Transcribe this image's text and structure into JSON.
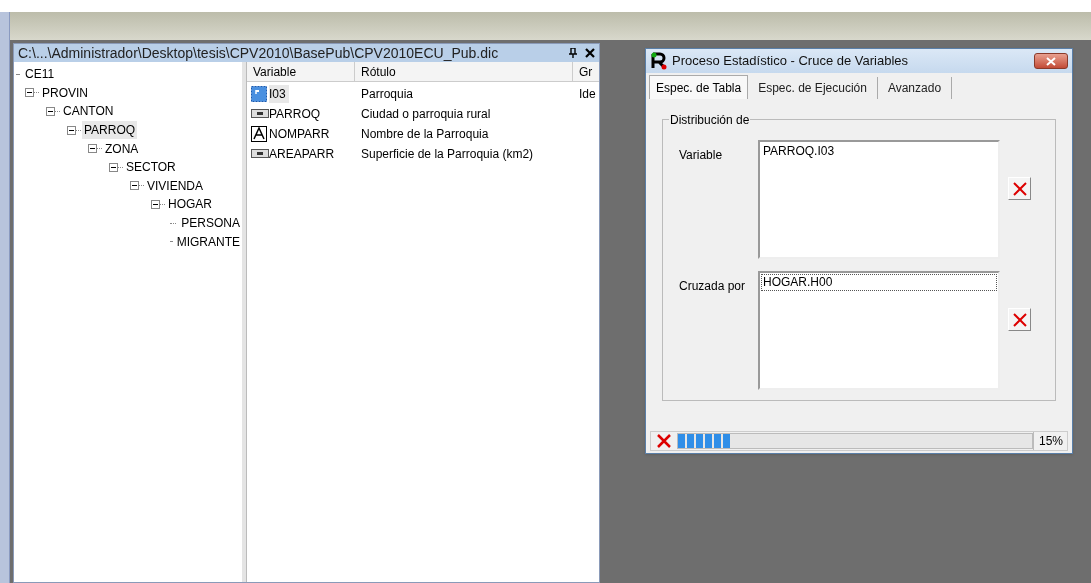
{
  "dictionary_panel": {
    "title": "C:\\...\\Administrador\\Desktop\\tesis\\CPV2010\\BasePub\\CPV2010ECU_Pub.dic",
    "tree": [
      {
        "label": "CE11",
        "selected": false,
        "children": [
          {
            "label": "PROVIN",
            "expanded": true,
            "selected": false,
            "children": [
              {
                "label": "CANTON",
                "expanded": true,
                "selected": false,
                "children": [
                  {
                    "label": "PARROQ",
                    "expanded": true,
                    "selected": true,
                    "children": [
                      {
                        "label": "ZONA",
                        "expanded": true,
                        "selected": false,
                        "children": [
                          {
                            "label": "SECTOR",
                            "expanded": true,
                            "selected": false,
                            "children": [
                              {
                                "label": "VIVIENDA",
                                "expanded": true,
                                "selected": false,
                                "children": [
                                  {
                                    "label": "HOGAR",
                                    "expanded": true,
                                    "selected": false,
                                    "children": [
                                      {
                                        "label": "PERSONA",
                                        "selected": false
                                      },
                                      {
                                        "label": "MIGRANTE",
                                        "selected": false
                                      }
                                    ]
                                  }
                                ]
                              }
                            ]
                          }
                        ]
                      }
                    ]
                  }
                ]
              }
            ]
          }
        ]
      }
    ],
    "list": {
      "columns": [
        "Variable",
        "Rótulo",
        "Gr"
      ],
      "rows": [
        {
          "kind": "id",
          "variable": "I03",
          "label": "Parroquia",
          "column_3": "Ide",
          "selected": true
        },
        {
          "kind": "numeric",
          "variable": "PARROQ",
          "label": "Ciudad o parroquia rural",
          "selected": false
        },
        {
          "kind": "alpha",
          "variable": "NOMPARR",
          "label": "Nombre de la Parroquia",
          "selected": false
        },
        {
          "kind": "numeric",
          "variable": "AREAPARR",
          "label": "Superficie de la Parroquia (km2)",
          "selected": false
        }
      ]
    }
  },
  "dialog": {
    "title": "Proceso Estadístico - Cruce de Variables",
    "tabs": [
      {
        "label": "Espec. de Tabla",
        "selected": true
      },
      {
        "label": "Espec. de Ejecución",
        "selected": false
      },
      {
        "label": "Avanzado",
        "selected": false
      }
    ],
    "group_title": "Distribución de",
    "fields": [
      {
        "label": "Variable",
        "items": [
          {
            "text": "PARROQ.I03",
            "focused": false
          }
        ]
      },
      {
        "label": "Cruzada por",
        "items": [
          {
            "text": "HOGAR.H00",
            "focused": true
          }
        ]
      }
    ],
    "progress": {
      "level": 0.15,
      "reading": "15%"
    }
  }
}
